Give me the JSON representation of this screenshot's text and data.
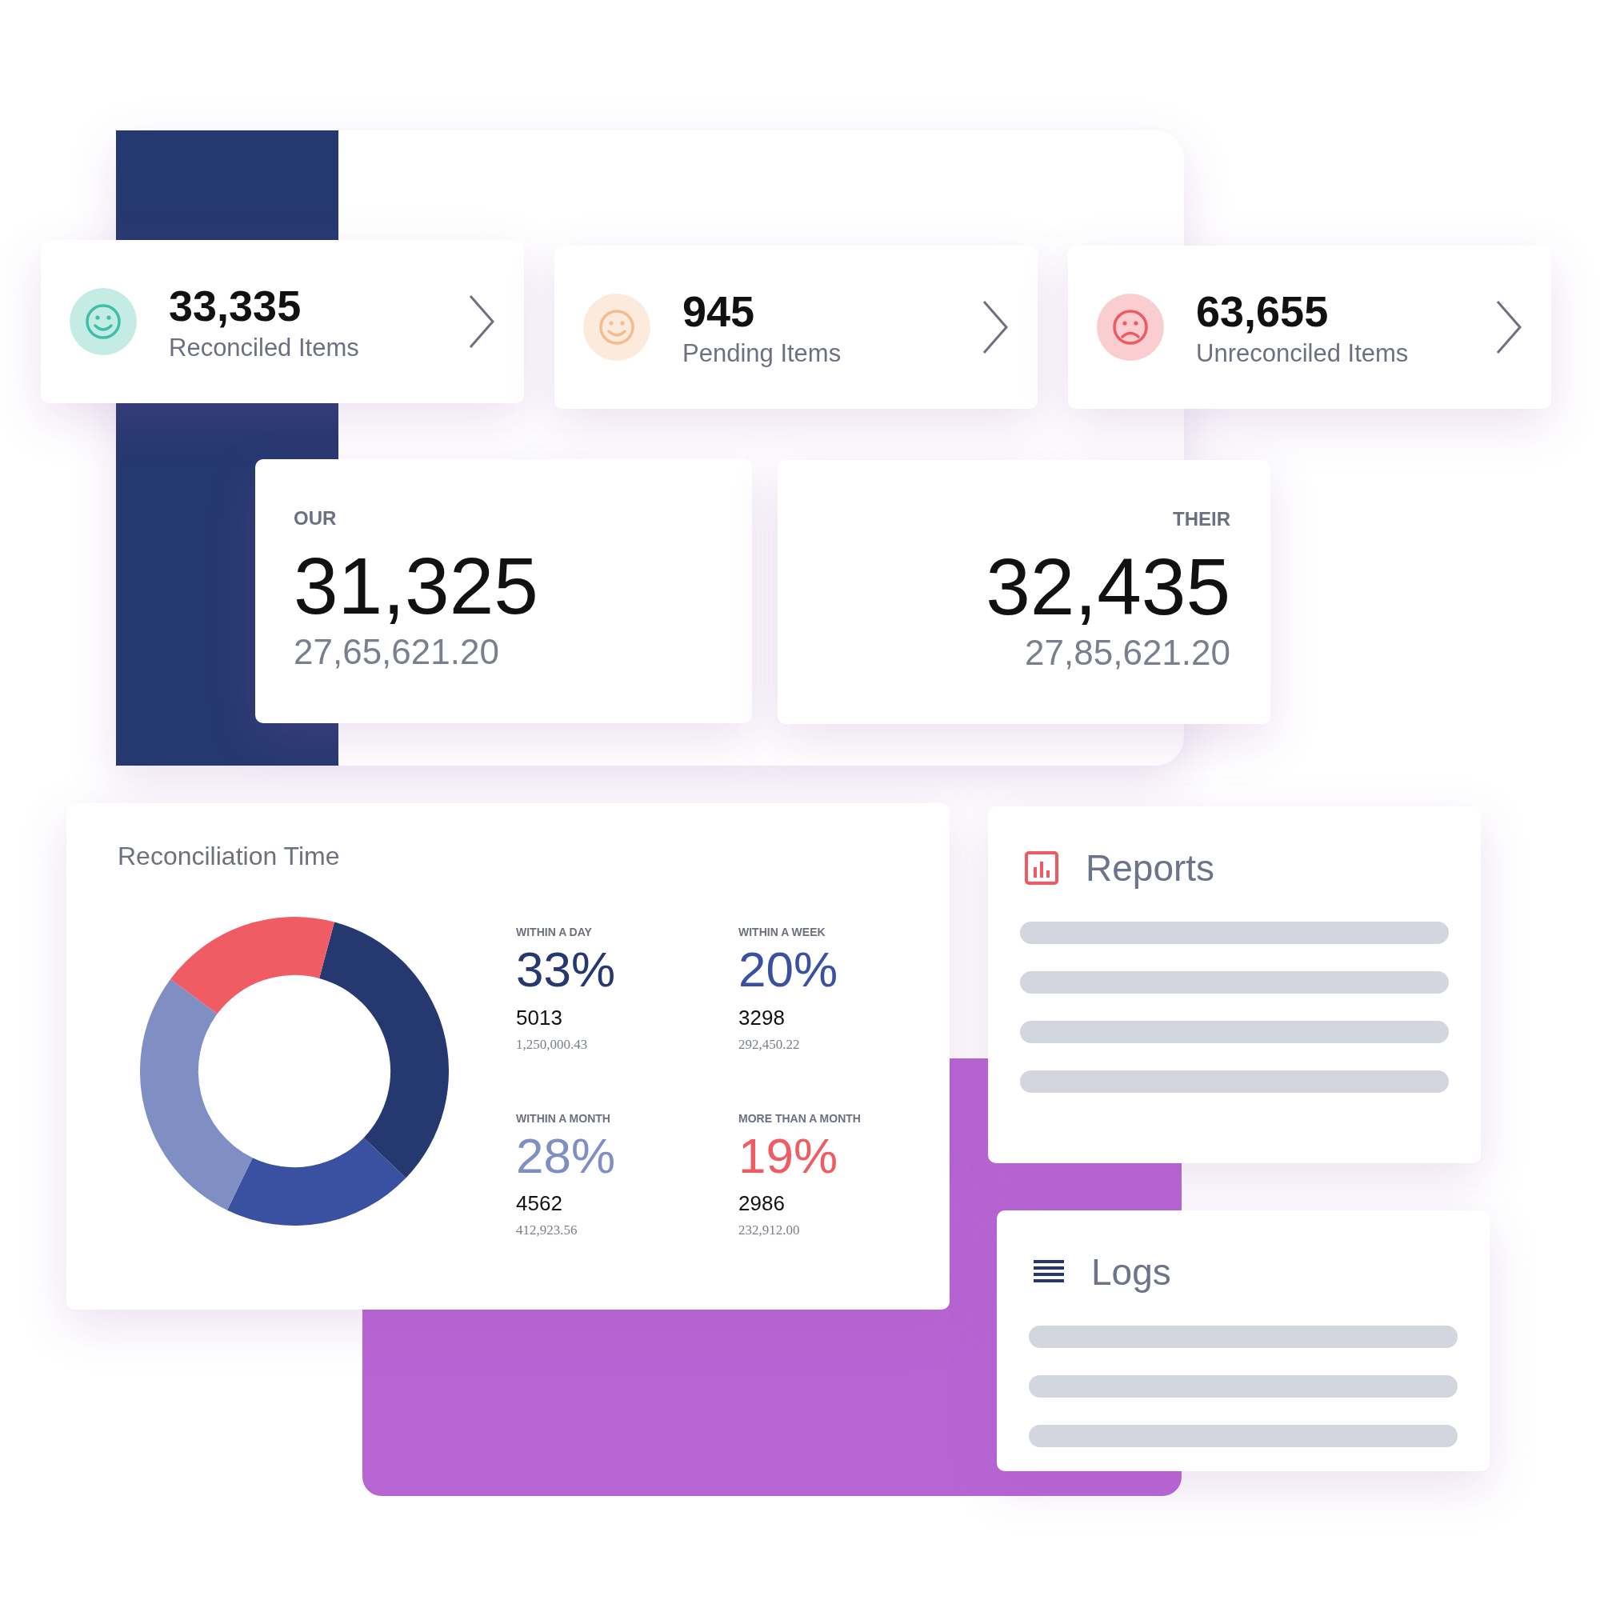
{
  "summary_cards": [
    {
      "value": "33,335",
      "label": "Reconciled Items",
      "kind": "happy",
      "color": "#3cc0a8"
    },
    {
      "value": "945",
      "label": "Pending Items",
      "kind": "happy",
      "color": "#f6bb8e"
    },
    {
      "value": "63,655",
      "label": "Unreconciled Items",
      "kind": "sad",
      "color": "#ef5a62"
    }
  ],
  "totals": [
    {
      "heading": "OUR",
      "count": "31,325",
      "amount": "27,65,621.20"
    },
    {
      "heading": "THEIR",
      "count": "32,435",
      "amount": "27,85,621.20"
    }
  ],
  "reconciliation": {
    "stats": [
      {
        "percent": "33%",
        "count": "5013",
        "amount": "1,250,000.43",
        "color": "#263870"
      },
      {
        "percent": "20%",
        "count": "3298",
        "amount": "292,450.22",
        "color": "#3a50a0"
      },
      {
        "percent": "28%",
        "count": "4562",
        "amount": "412,923.56",
        "color": "#7f8fc4"
      },
      {
        "percent": "19%",
        "count": "2986",
        "amount": "232,912.00",
        "color": "#f05c63"
      }
    ],
    "chart_data": {
      "type": "donut",
      "title": "Reconciliation Time",
      "categories": [
        "WITHIN A DAY",
        "WITHIN A WEEK",
        "WITHIN A MONTH",
        "MORE THAN A MONTH"
      ],
      "values": [
        33,
        20,
        28,
        19
      ]
    }
  },
  "reports": {
    "title": "Reports"
  },
  "logs": {
    "title": "Logs"
  }
}
